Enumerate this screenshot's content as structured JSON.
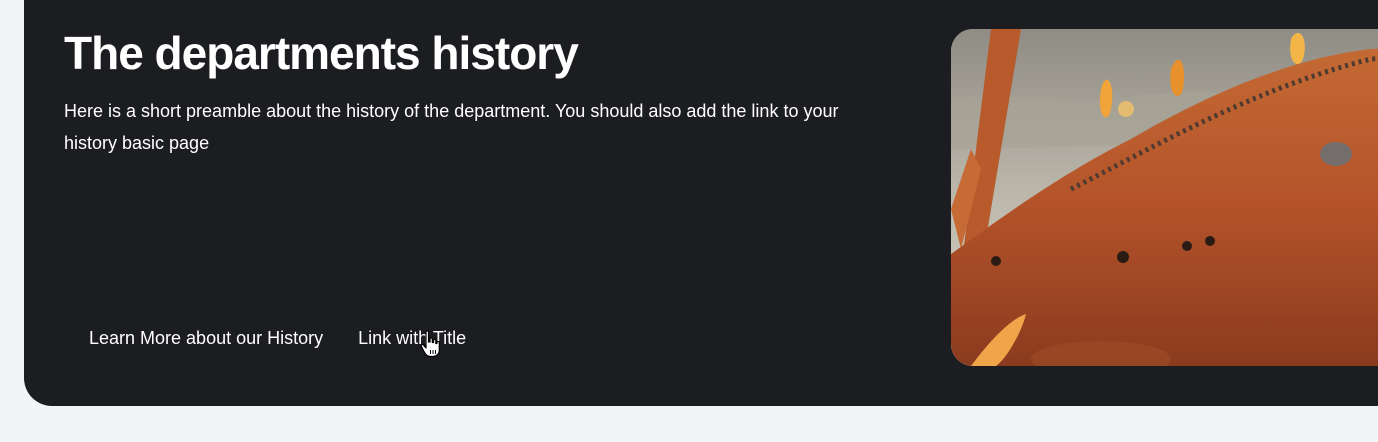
{
  "hero": {
    "title": "The departments history",
    "preamble": "Here is a short preamble about the history of the department. You should also add the link to your history basic page",
    "links": [
      {
        "label": "Learn More about our History"
      },
      {
        "label": "Link with Title"
      }
    ],
    "image_icon": "illustration-image",
    "colors": {
      "background": "#f3f4f8",
      "card": "#1c1d21",
      "text": "#ffffff",
      "image_primary": "#b5532a"
    }
  }
}
